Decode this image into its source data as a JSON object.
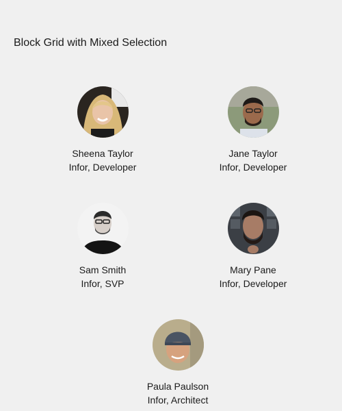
{
  "page": {
    "title": "Block Grid with Mixed Selection"
  },
  "blocks": [
    {
      "name": "Sheena Taylor",
      "role": "Infor, Developer",
      "avatar_icon": "person-photo-avatar"
    },
    {
      "name": "Jane Taylor",
      "role": "Infor, Developer",
      "avatar_icon": "person-photo-avatar"
    },
    {
      "name": "Sam Smith",
      "role": "Infor, SVP",
      "avatar_icon": "person-photo-avatar"
    },
    {
      "name": "Mary Pane",
      "role": "Infor, Developer",
      "avatar_icon": "person-photo-avatar"
    },
    {
      "name": "Paula Paulson",
      "role": "Infor, Architect",
      "avatar_icon": "person-photo-avatar"
    }
  ],
  "colors": {
    "background": "#f0f0f0",
    "text": "#1a1a1a"
  }
}
